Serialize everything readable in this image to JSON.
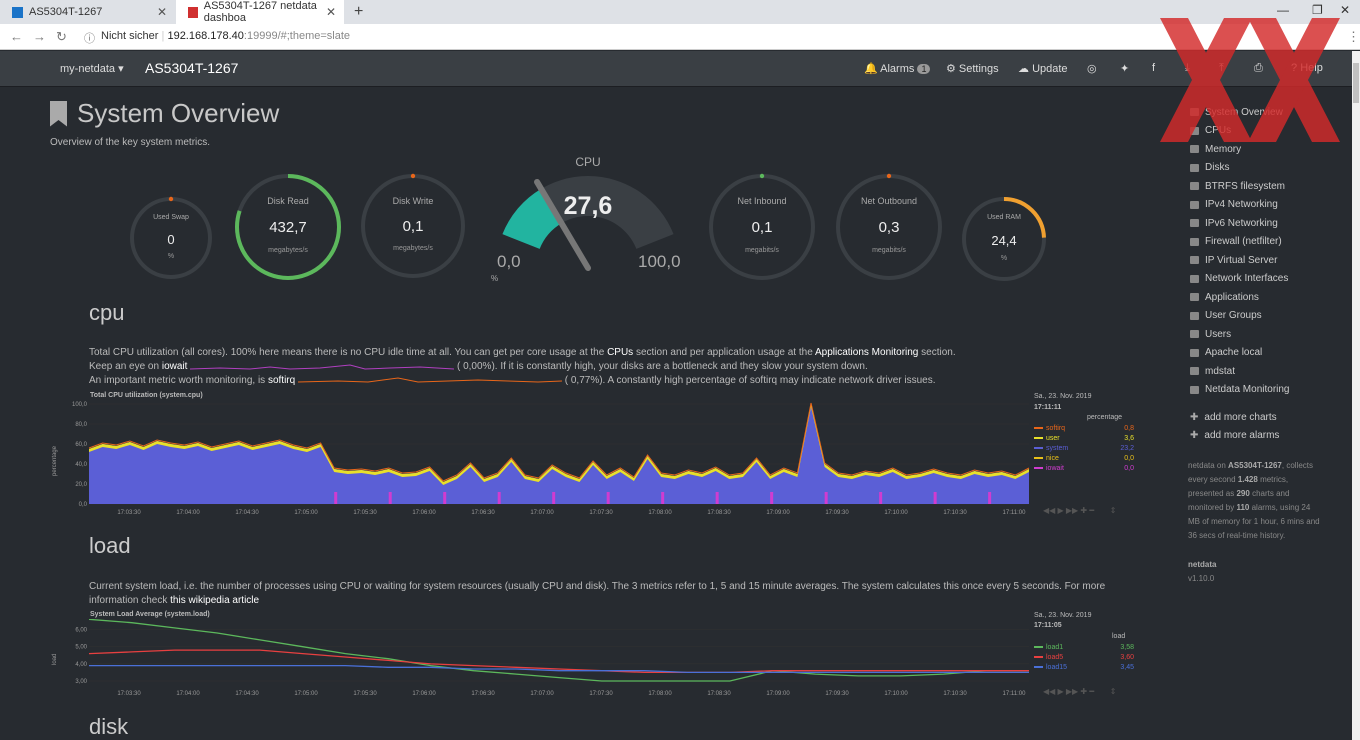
{
  "browser": {
    "tabs": [
      {
        "label": "AS5304T-1267"
      },
      {
        "label": "AS5304T-1267 netdata dashboa"
      }
    ],
    "security": "Nicht sicher",
    "url_host": "192.168.178.40",
    "url_path": ":19999/#;theme=slate"
  },
  "navbar": {
    "brand": "my-netdata",
    "hostname": "AS5304T-1267",
    "alarms_label": "Alarms",
    "alarms_count": "1",
    "settings_label": "Settings",
    "update_label": "Update",
    "help_label": "Help"
  },
  "overview": {
    "title": "System Overview",
    "subtitle": "Overview of the key system metrics."
  },
  "gauges": [
    {
      "label": "Used Swap",
      "value": "0",
      "unit": "%",
      "fill": 0.0,
      "color": "#e8661a"
    },
    {
      "label": "Disk Read",
      "value": "432,7",
      "unit": "megabytes/s",
      "fill": 0.8,
      "color": "#5cb85c"
    },
    {
      "label": "Disk Write",
      "value": "0,1",
      "unit": "megabytes/s",
      "fill": 0.0,
      "color": "#e8661a"
    },
    {
      "label": "Net Inbound",
      "value": "0,1",
      "unit": "megabits/s",
      "fill": 0.0,
      "color": "#5cb85c"
    },
    {
      "label": "Net Outbound",
      "value": "0,3",
      "unit": "megabits/s",
      "fill": 0.0,
      "color": "#e8661a"
    },
    {
      "label": "Used RAM",
      "value": "24,4",
      "unit": "%",
      "fill": 0.244,
      "color": "#f0a030"
    }
  ],
  "cpu_gauge": {
    "label": "CPU",
    "value": "27,6",
    "min": "0,0",
    "max": "100,0",
    "unit": "%",
    "fraction": 0.276,
    "color": "#22b4a0"
  },
  "cpu_section": {
    "heading": "cpu",
    "line1_a": "Total CPU utilization (all cores). 100% here means there is no CPU idle time at all. You can get per core usage at the ",
    "line1_link1": "CPUs",
    "line1_b": " section and per application usage at the ",
    "line1_link2": "Applications Monitoring",
    "line1_c": " section.",
    "line2_a": "Keep an eye on ",
    "line2_b": "iowait",
    "line2_c": "0,00%). If it is constantly high, your disks are a bottleneck and they slow your system down.",
    "line3_a": "An important metric worth monitoring, is ",
    "line3_b": "softirq",
    "line3_c": "0,77%). A constantly high percentage of softirq may indicate network driver issues.",
    "chart_title": "Total CPU utilization (system.cpu)",
    "date": "Sa., 23. Nov. 2019",
    "time": "17:11:11",
    "legend_header": "percentage",
    "ylabel": "percentage"
  },
  "load_section": {
    "heading": "load",
    "text_a": "Current system load, i.e. the number of processes using CPU or waiting for system resources (usually CPU and disk). The 3 metrics refer to 1, 5 and 15 minute averages. The system calculates this once every 5 seconds. For more",
    "text_b": "information check ",
    "link": "this wikipedia article",
    "chart_title": "System Load Average (system.load)",
    "date": "Sa., 23. Nov. 2019",
    "time": "17:11:05",
    "legend_header": "load",
    "ylabel": "load"
  },
  "disk_section": {
    "heading": "disk"
  },
  "menu": [
    {
      "label": "System Overview"
    },
    {
      "label": "CPUs"
    },
    {
      "label": "Memory"
    },
    {
      "label": "Disks"
    },
    {
      "label": "BTRFS filesystem"
    },
    {
      "label": "IPv4 Networking"
    },
    {
      "label": "IPv6 Networking"
    },
    {
      "label": "Firewall (netfilter)"
    },
    {
      "label": "IP Virtual Server"
    },
    {
      "label": "Network Interfaces"
    },
    {
      "label": "Applications"
    },
    {
      "label": "User Groups"
    },
    {
      "label": "Users"
    },
    {
      "label": "Apache local"
    },
    {
      "label": "mdstat"
    },
    {
      "label": "Netdata Monitoring"
    }
  ],
  "menu_extra": {
    "add_charts": "add more charts",
    "add_alarms": "add more alarms"
  },
  "sidebar_info": {
    "l1a": "netdata on ",
    "l1b": "AS5304T-1267",
    ", collects": "",
    "l1c": ", collects",
    "l2a": "every second ",
    "l2b": "1.428",
    " metrics,": "",
    "l2c": " metrics,",
    "l3a": "presented as ",
    "l3b": "290",
    "l3c": " charts and",
    "l4a": "monitored by ",
    "l4b": "110",
    "l4c": " alarms, using 24",
    "l5": "MB of memory for 1 hour, 6 mins and",
    "l6": "36 secs of real-time history.",
    "ver_label": "netdata",
    "version": "v1.10.0"
  },
  "chart_data": [
    {
      "type": "area",
      "title": "Total CPU utilization (system.cpu)",
      "ylabel": "percentage",
      "ylim": [
        0,
        100
      ],
      "yticks": [
        "100,0",
        "80,0",
        "60,0",
        "40,0",
        "20,0",
        "0,0"
      ],
      "xticks": [
        "17:03:30",
        "17:04:00",
        "17:04:30",
        "17:05:00",
        "17:05:30",
        "17:06:00",
        "17:06:30",
        "17:07:00",
        "17:07:30",
        "17:08:00",
        "17:08:30",
        "17:09:00",
        "17:09:30",
        "17:10:00",
        "17:10:30",
        "17:11:00"
      ],
      "series": [
        {
          "name": "softirq",
          "value": "0,8",
          "color": "#e8661a"
        },
        {
          "name": "user",
          "value": "3,6",
          "color": "#e8e02a"
        },
        {
          "name": "system",
          "value": "23,2",
          "color": "#5b5fd6"
        },
        {
          "name": "nice",
          "value": "0,0",
          "color": "#e8c01a"
        },
        {
          "name": "iowait",
          "value": "0,0",
          "color": "#d03cd0"
        }
      ],
      "profile": [
        55,
        60,
        58,
        62,
        57,
        63,
        60,
        58,
        61,
        56,
        59,
        62,
        57,
        60,
        63,
        58,
        55,
        60,
        35,
        33,
        34,
        32,
        35,
        30,
        31,
        36,
        22,
        28,
        40,
        25,
        30,
        45,
        28,
        25,
        38,
        30,
        25,
        42,
        28,
        35,
        26,
        48,
        30,
        28,
        33,
        30,
        36,
        28,
        30,
        45,
        28,
        35,
        30,
        100,
        40,
        30,
        28,
        32,
        30,
        35,
        28,
        30,
        34,
        30,
        28,
        33,
        30,
        32,
        28,
        35
      ]
    },
    {
      "type": "line",
      "title": "System Load Average (system.load)",
      "ylabel": "load",
      "ylim": [
        3,
        6.5
      ],
      "yticks": [
        "6,00",
        "5,00",
        "4,00",
        "3,00"
      ],
      "xticks": [
        "17:03:30",
        "17:04:00",
        "17:04:30",
        "17:05:00",
        "17:05:30",
        "17:06:00",
        "17:06:30",
        "17:07:00",
        "17:07:30",
        "17:08:00",
        "17:08:30",
        "17:09:00",
        "17:09:30",
        "17:10:00",
        "17:10:30",
        "17:11:00"
      ],
      "series": [
        {
          "name": "load1",
          "value": "3,58",
          "color": "#5cb85c",
          "values": [
            6.6,
            6.4,
            6.1,
            5.8,
            5.4,
            5.0,
            4.6,
            4.3,
            3.9,
            3.6,
            3.4,
            3.2,
            3.0,
            2.9,
            2.8,
            2.8,
            3.6,
            3.4,
            3.3,
            3.3,
            3.4,
            3.6,
            3.6
          ]
        },
        {
          "name": "load5",
          "value": "3,60",
          "color": "#e84040",
          "values": [
            4.6,
            4.7,
            4.8,
            4.8,
            4.8,
            4.6,
            4.4,
            4.2,
            4.0,
            3.9,
            3.8,
            3.7,
            3.6,
            3.5,
            3.5,
            3.5,
            3.6,
            3.6,
            3.6,
            3.6,
            3.6,
            3.6,
            3.6
          ]
        },
        {
          "name": "load15",
          "value": "3,45",
          "color": "#4a70d8",
          "values": [
            3.9,
            3.9,
            3.9,
            3.9,
            3.9,
            3.9,
            3.9,
            3.8,
            3.8,
            3.7,
            3.7,
            3.6,
            3.6,
            3.6,
            3.5,
            3.5,
            3.5,
            3.5,
            3.5,
            3.5,
            3.5,
            3.5,
            3.5
          ]
        }
      ]
    }
  ]
}
